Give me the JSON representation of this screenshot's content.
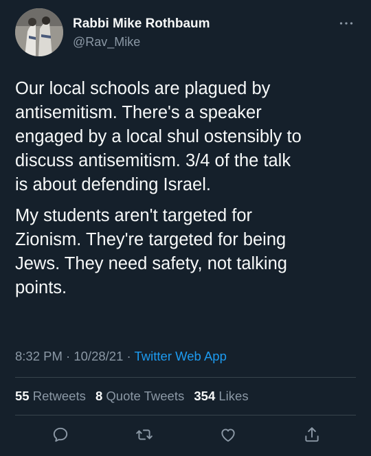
{
  "author": {
    "display_name": "Rabbi Mike Rothbaum",
    "handle": "@Rav_Mike",
    "avatar_icon": "profile-photo"
  },
  "more_icon": "more-dots-icon",
  "tweet": {
    "paragraphs": [
      "Our local schools are plagued by\nantisemitism. There's a speaker\nengaged by a local shul ostensibly to\ndiscuss antisemitism. 3/4 of the talk\nis about defending Israel.",
      "My students aren't targeted for\nZionism. They're targeted for being\nJews. They need safety, not talking\npoints."
    ]
  },
  "meta": {
    "time": "8:32 PM",
    "separator": "·",
    "date": "10/28/21",
    "source": "Twitter Web App"
  },
  "stats": {
    "retweets_count": "55",
    "retweets_label": "Retweets",
    "quotes_count": "8",
    "quotes_label": "Quote Tweets",
    "likes_count": "354",
    "likes_label": "Likes"
  },
  "actions": [
    "reply-icon",
    "retweet-icon",
    "like-icon",
    "share-icon"
  ],
  "colors": {
    "background": "#15202b",
    "text": "#f7f9f9",
    "secondary": "#8b98a5",
    "accent": "#1d9bf0",
    "divider": "#38444d"
  }
}
